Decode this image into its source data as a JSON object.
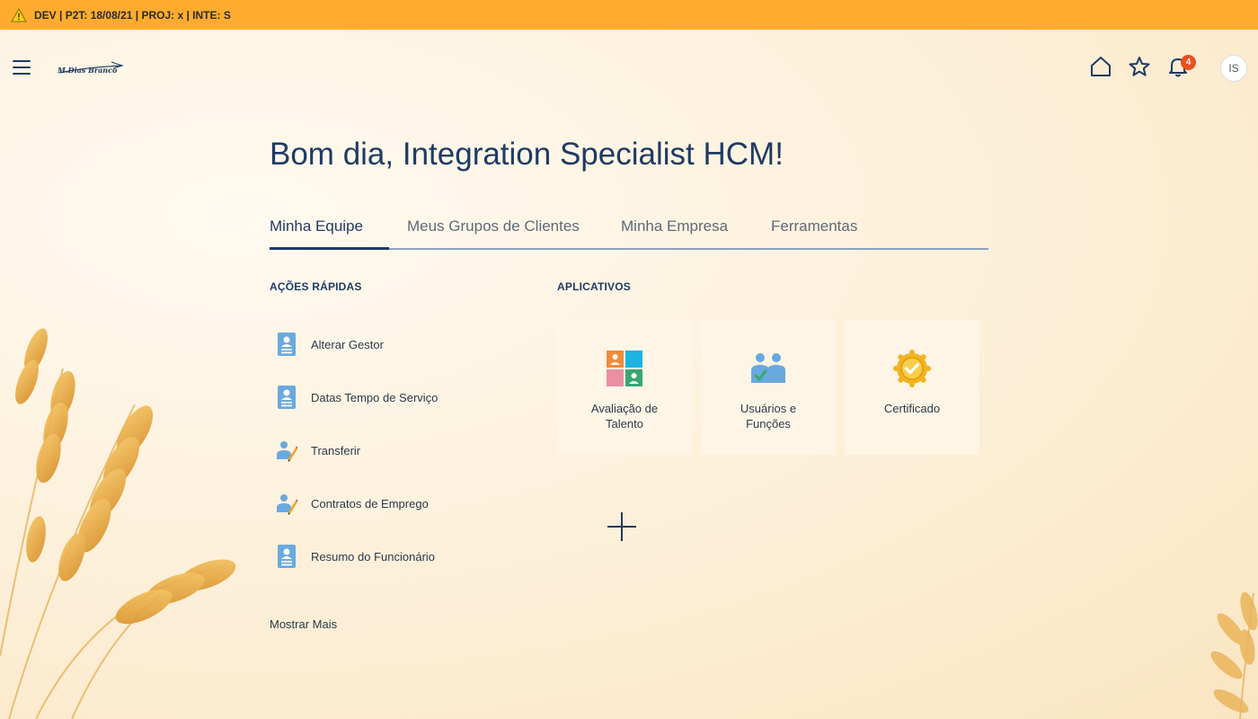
{
  "env_banner": {
    "text": "DEV | P2T: 18/08/21 | PROJ: x | INTE: S",
    "color": "#ffab2e"
  },
  "header": {
    "logo_text": "M.Dias Branco",
    "notifications_count": "4",
    "avatar_initials": "IS",
    "icons": [
      "menu-icon",
      "home-icon",
      "star-icon",
      "bell-icon"
    ]
  },
  "greeting": "Bom dia, Integration Specialist HCM!",
  "tabs": [
    {
      "label": "Minha Equipe",
      "active": true
    },
    {
      "label": "Meus Grupos de Clientes",
      "active": false
    },
    {
      "label": "Minha Empresa",
      "active": false
    },
    {
      "label": "Ferramentas",
      "active": false
    }
  ],
  "quick_actions": {
    "title": "AÇÕES RÁPIDAS",
    "items": [
      {
        "label": "Alterar Gestor",
        "icon": "employee-card-icon"
      },
      {
        "label": "Datas Tempo de Serviço",
        "icon": "employee-card-icon"
      },
      {
        "label": "Transferir",
        "icon": "person-edit-icon"
      },
      {
        "label": "Contratos de Emprego",
        "icon": "person-edit-icon"
      },
      {
        "label": "Resumo do Funcionário",
        "icon": "employee-card-icon"
      }
    ],
    "show_more": "Mostrar Mais"
  },
  "apps": {
    "title": "APLICATIVOS",
    "items": [
      {
        "label": "Avaliação de Talento",
        "icon": "talent-review-icon"
      },
      {
        "label": "Usuários e Funções",
        "icon": "users-roles-icon"
      },
      {
        "label": "Certificado",
        "icon": "certificate-icon"
      }
    ]
  },
  "colors": {
    "primary": "#1f3b63",
    "badge": "#e8501f"
  }
}
